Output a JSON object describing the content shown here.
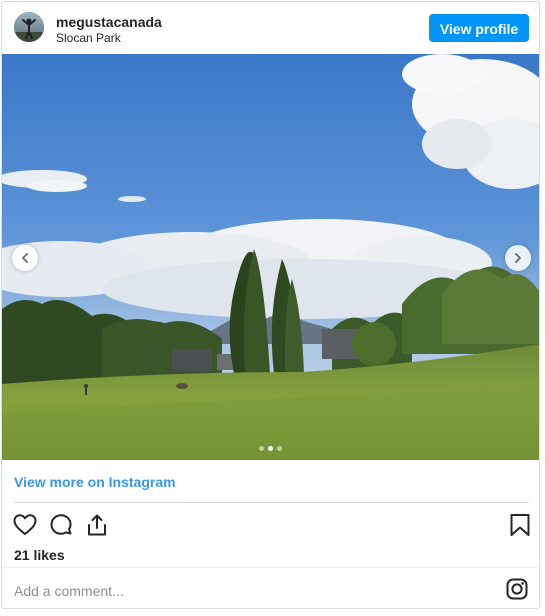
{
  "header": {
    "username": "megustacanada",
    "location": "Slocan Park",
    "view_profile_label": "View profile"
  },
  "post": {
    "image_alt": "Slocan Park",
    "carousel_dots": 3,
    "active_dot_index": 1
  },
  "view_more_label": "View more on Instagram",
  "actions": {
    "like_icon": "heart-icon",
    "comment_icon": "comment-icon",
    "share_icon": "share-icon",
    "save_icon": "bookmark-icon"
  },
  "likes_text": "21 likes",
  "comment": {
    "placeholder": "Add a comment..."
  },
  "colors": {
    "accent": "#0095f6",
    "link": "#3897f0",
    "border": "#dbdbdb"
  }
}
